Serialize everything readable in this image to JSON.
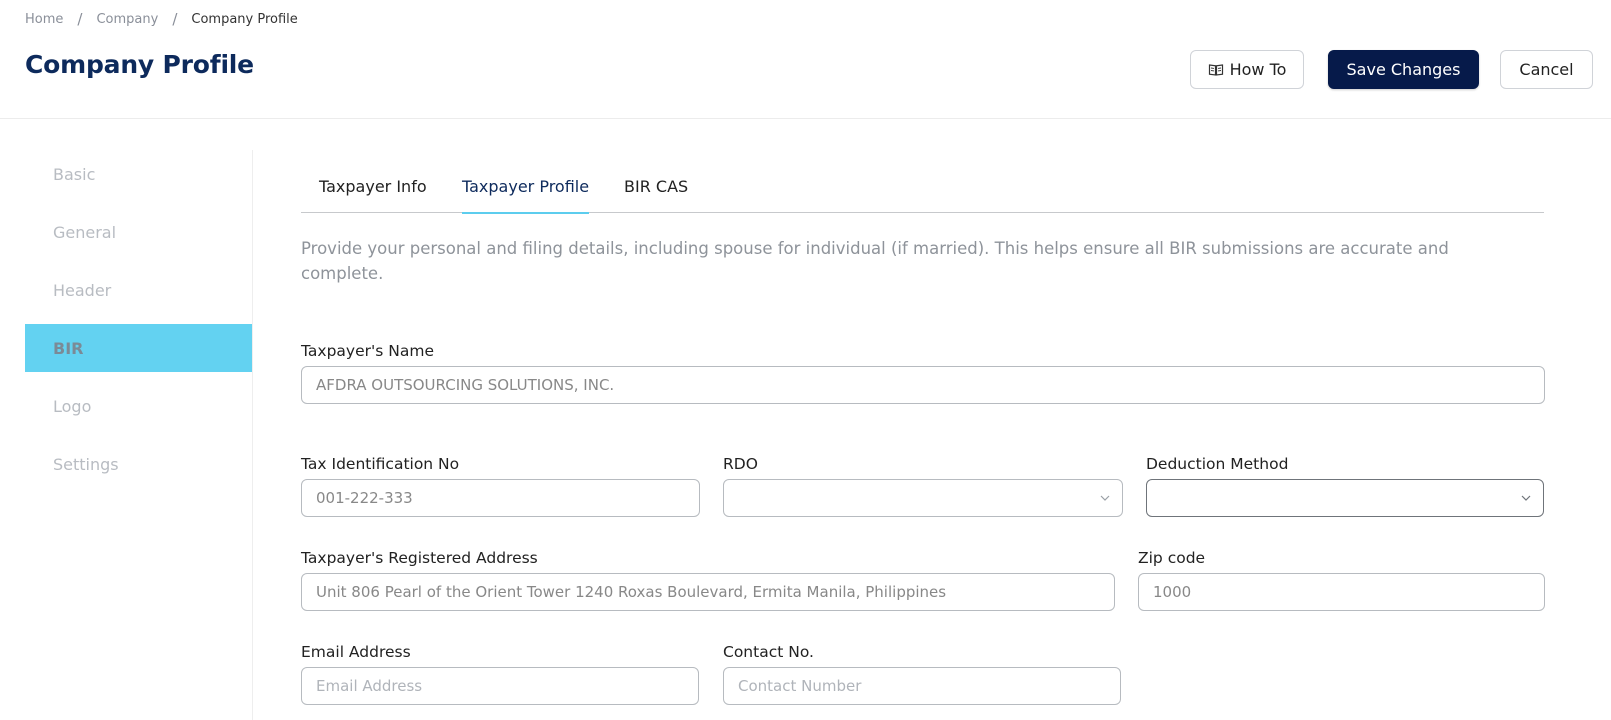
{
  "breadcrumb": {
    "items": [
      "Home",
      "Company",
      "Company Profile"
    ],
    "separator": "/"
  },
  "page_title": "Company Profile",
  "toolbar": {
    "howto_label": "How To",
    "save_label": "Save Changes",
    "cancel_label": "Cancel"
  },
  "sidebar": {
    "items": [
      {
        "label": "Basic"
      },
      {
        "label": "General"
      },
      {
        "label": "Header"
      },
      {
        "label": "BIR"
      },
      {
        "label": "Logo"
      },
      {
        "label": "Settings"
      }
    ],
    "active": "BIR"
  },
  "tabs": {
    "items": [
      {
        "label": "Taxpayer Info"
      },
      {
        "label": "Taxpayer Profile"
      },
      {
        "label": "BIR CAS"
      }
    ],
    "active": "Taxpayer Profile"
  },
  "description": "Provide your personal and filing details, including spouse for individual (if married). This helps ensure all BIR submissions are accurate and complete.",
  "form": {
    "taxpayer_name": {
      "label": "Taxpayer's Name",
      "value": "AFDRA OUTSOURCING SOLUTIONS, INC."
    },
    "tin": {
      "label": "Tax Identification No",
      "value": "001-222-333"
    },
    "rdo": {
      "label": "RDO",
      "value": ""
    },
    "deduction_method": {
      "label": "Deduction Method",
      "value": ""
    },
    "address": {
      "label": "Taxpayer's Registered Address",
      "value": "Unit 806 Pearl of the Orient Tower 1240 Roxas Boulevard, Ermita Manila, Philippines"
    },
    "zip": {
      "label": "Zip code",
      "value": "1000"
    },
    "email": {
      "label": "Email Address",
      "value": "",
      "placeholder": "Email Address"
    },
    "contact": {
      "label": "Contact No.",
      "value": "",
      "placeholder": "Contact Number"
    }
  },
  "colors": {
    "title": "#0d2a5c",
    "primary_button": "#061a4a",
    "active_sidebar": "#63d2f1",
    "active_tab_underline": "#5ccdee"
  },
  "icons": {
    "howto": "book-icon",
    "select": "chevron-down-icon"
  }
}
